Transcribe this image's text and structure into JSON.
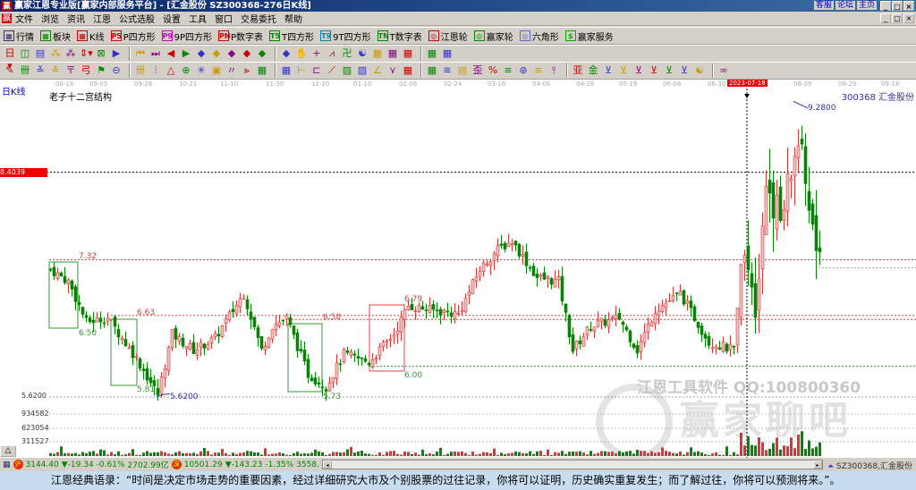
{
  "window": {
    "title": "赢家江恩专业版[赢家内部服务平台] - [汇金股份    SZ300368-276日K线]",
    "links": [
      "客服",
      "论坛",
      "主页"
    ],
    "buttons": [
      "_",
      "□",
      "×"
    ]
  },
  "menu": [
    "文件",
    "浏览",
    "资讯",
    "江恩",
    "公式选股",
    "设置",
    "工具",
    "窗口",
    "交易委托",
    "帮助"
  ],
  "toolbar1": [
    {
      "label": "行情",
      "icon": "quote-icon",
      "c": "#336"
    },
    {
      "label": "板块",
      "icon": "sector-icon",
      "c": "#080"
    },
    {
      "label": "K线",
      "icon": "kline-icon",
      "c": "#c00"
    },
    {
      "label": "P四方形",
      "icon": "P5",
      "c": "#c00"
    },
    {
      "label": "9P四方形",
      "icon": "P9",
      "c": "#c0c"
    },
    {
      "label": "P数字表",
      "icon": "PN",
      "c": "#c00"
    },
    {
      "label": "T四方形",
      "icon": "T5",
      "c": "#080"
    },
    {
      "label": "9T四方形",
      "icon": "T9",
      "c": "#08a"
    },
    {
      "label": "T数字表",
      "icon": "TN",
      "c": "#080"
    },
    {
      "label": "江恩轮",
      "icon": "◎",
      "c": "#c00"
    },
    {
      "label": "赢家轮",
      "icon": "◎",
      "c": "#080"
    },
    {
      "label": "六角形",
      "icon": "◎",
      "c": "#66c"
    },
    {
      "label": "赢家服务",
      "icon": "$",
      "c": "#0a0"
    }
  ],
  "toolbar2": [
    "日▾",
    "◫",
    "▤",
    "⁂",
    "⁂",
    "⇕▾",
    "⊠",
    "▶",
    "⏮",
    "⏭",
    "◀",
    "▶",
    "◆",
    "◆",
    "◆",
    "◆",
    "◆",
    "◆",
    "✋",
    "+",
    "⩘",
    "卍",
    "☯",
    "▦",
    "▦",
    "▦",
    "▦",
    "▦"
  ],
  "toolbar3": [
    "✎",
    "卌",
    "≚",
    "≚",
    "〒",
    "弓",
    "⚑",
    "⊖",
    "卌",
    "⫶",
    "△",
    "⊕",
    "✳",
    "▣",
    "〃",
    "⫸",
    "▦",
    "▦",
    "⊢",
    "⊏",
    "⟋",
    "▨",
    "▨",
    "∠",
    "⋎",
    "▦",
    "▦",
    "≋",
    "▤",
    "歪",
    "%",
    "≡",
    "⊛",
    "≡",
    "⫯",
    "亚",
    "金",
    "⊻",
    "⊻",
    "⊻",
    "⊻",
    "⊻",
    "⊻",
    "☯",
    "∞"
  ],
  "axis": {
    "dates": [
      "08-16",
      "09-05",
      "09-26",
      "10-21",
      "11-10",
      "11-30",
      "12-20",
      "01-10",
      "02-06",
      "02-24",
      "03-16",
      "04-06",
      "04-26",
      "05-19",
      "06-08",
      "06-30",
      "08-09",
      "08-29",
      "09-18"
    ],
    "current": "2023-07-18"
  },
  "chart": {
    "period": "日K线",
    "indicator": "老子十二宫结构",
    "stock": "300368  汇金股份",
    "high_label": "9.2800",
    "low_label": "5.6200",
    "cursor_price": "8.4039",
    "min_price": "5.6200",
    "levels": [
      "7.32",
      "6.50",
      "6.63",
      "5.81",
      "6.58",
      "5.73",
      "6.79",
      "6.00"
    ],
    "volume_ticks": [
      "934582",
      "623054",
      "311527"
    ],
    "price_keypoints": [
      [
        0,
        7.2
      ],
      [
        5,
        7.05
      ],
      [
        10,
        6.55
      ],
      [
        16,
        6.6
      ],
      [
        24,
        6.1
      ],
      [
        30,
        5.65
      ],
      [
        34,
        6.4
      ],
      [
        40,
        6.2
      ],
      [
        46,
        6.35
      ],
      [
        54,
        6.9
      ],
      [
        59,
        6.2
      ],
      [
        62,
        6.5
      ],
      [
        66,
        6.6
      ],
      [
        72,
        5.9
      ],
      [
        77,
        5.75
      ],
      [
        82,
        6.15
      ],
      [
        89,
        6.05
      ],
      [
        96,
        6.4
      ],
      [
        100,
        6.75
      ],
      [
        106,
        6.7
      ],
      [
        114,
        6.65
      ],
      [
        120,
        7.2
      ],
      [
        125,
        7.45
      ],
      [
        129,
        7.55
      ],
      [
        136,
        7.1
      ],
      [
        142,
        7.05
      ],
      [
        146,
        6.2
      ],
      [
        151,
        6.5
      ],
      [
        159,
        6.6
      ],
      [
        164,
        6.2
      ],
      [
        169,
        6.7
      ],
      [
        176,
        6.9
      ],
      [
        184,
        6.3
      ],
      [
        191,
        6.2
      ],
      [
        194,
        7.6
      ],
      [
        197,
        6.8
      ],
      [
        200,
        8.3
      ],
      [
        204,
        7.8
      ],
      [
        209,
        8.8
      ],
      [
        212,
        8.0
      ],
      [
        215,
        7.2
      ]
    ]
  },
  "watermark": {
    "line1": "江恩工具软件  QQ:100800360",
    "line2": "赢家聊吧"
  },
  "status": {
    "sh_index": "3144.40",
    "sh_change": "▼-19.34",
    "sh_pct": "-0.61%",
    "sh_amount": "2702.99亿",
    "sz_index": "10501.29",
    "sz_change": "▼-143.23",
    "sz_pct": "-1.35%",
    "sz_amount": "3558.",
    "stock": "SZ300368,汇金股份"
  },
  "quote": "江恩经典语录：“时间是决定市场走势的重要因素，经过详细研究大市及个别股票的过往记录，你将可以证明，历史确实重复发生；而了解过往，你将可以预测将来。”。"
}
